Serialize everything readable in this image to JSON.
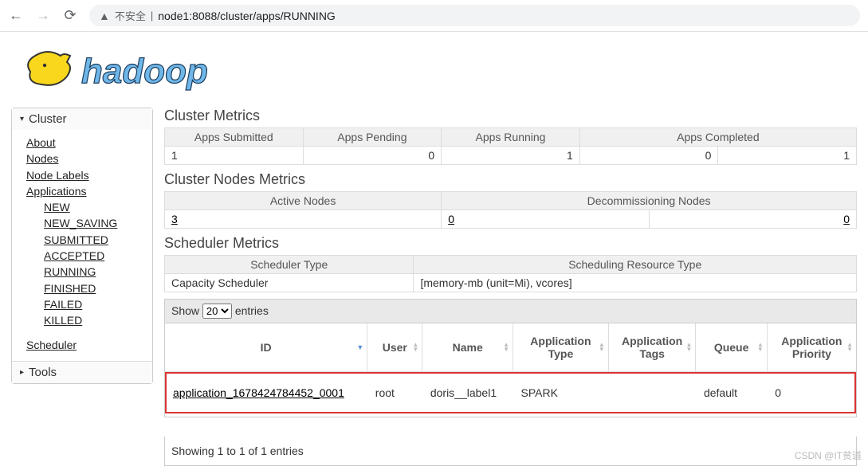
{
  "browser": {
    "security": "不安全",
    "url": "node1:8088/cluster/apps/RUNNING"
  },
  "sidebar": {
    "cluster_label": "Cluster",
    "about": "About",
    "nodes": "Nodes",
    "node_labels": "Node Labels",
    "applications": "Applications",
    "states": [
      "NEW",
      "NEW_SAVING",
      "SUBMITTED",
      "ACCEPTED",
      "RUNNING",
      "FINISHED",
      "FAILED",
      "KILLED"
    ],
    "scheduler": "Scheduler",
    "tools_label": "Tools"
  },
  "cluster_metrics": {
    "title": "Cluster Metrics",
    "headers": [
      "Apps Submitted",
      "Apps Pending",
      "Apps Running",
      "Apps Completed"
    ],
    "values": [
      "1",
      "0",
      "1",
      "0",
      "1"
    ]
  },
  "nodes_metrics": {
    "title": "Cluster Nodes Metrics",
    "headers": [
      "Active Nodes",
      "Decommissioning Nodes"
    ],
    "values": [
      "3",
      "0",
      "0"
    ]
  },
  "scheduler_metrics": {
    "title": "Scheduler Metrics",
    "headers": [
      "Scheduler Type",
      "Scheduling Resource Type"
    ],
    "values": [
      "Capacity Scheduler",
      "[memory-mb (unit=Mi), vcores]"
    ]
  },
  "entries": {
    "show": "Show",
    "count": "20",
    "suffix": "entries"
  },
  "apps": {
    "headers": {
      "id": "ID",
      "user": "User",
      "name": "Name",
      "type": "Application\nType",
      "tags": "Application\nTags",
      "queue": "Queue",
      "priority": "Application\nPriority"
    },
    "rows": [
      {
        "id": "application_1678424784452_0001",
        "user": "root",
        "name": "doris__label1",
        "type": "SPARK",
        "tags": "",
        "queue": "default",
        "priority": "0"
      }
    ]
  },
  "status": "Showing 1 to 1 of 1 entries",
  "attribution": "CSDN @IT贫道"
}
